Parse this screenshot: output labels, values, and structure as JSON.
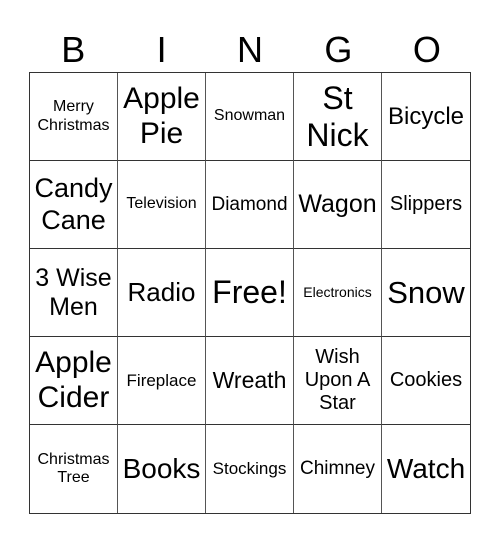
{
  "header": {
    "letters": [
      "B",
      "I",
      "N",
      "G",
      "O"
    ]
  },
  "card": {
    "rows": [
      [
        "Merry Christmas",
        "Apple Pie",
        "Snowman",
        "St Nick",
        "Bicycle"
      ],
      [
        "Candy Cane",
        "Television",
        "Diamond",
        "Wagon",
        "Slippers"
      ],
      [
        "3 Wise Men",
        "Radio",
        "Free!",
        "Electronics",
        "Snow"
      ],
      [
        "Apple Cider",
        "Fireplace",
        "Wreath",
        "Wish Upon A Star",
        "Cookies"
      ],
      [
        "Christmas Tree",
        "Books",
        "Stockings",
        "Chimney",
        "Watch"
      ]
    ]
  },
  "colors": {
    "background": "#ffffff",
    "text": "#000000",
    "grid_line": "#333333"
  }
}
